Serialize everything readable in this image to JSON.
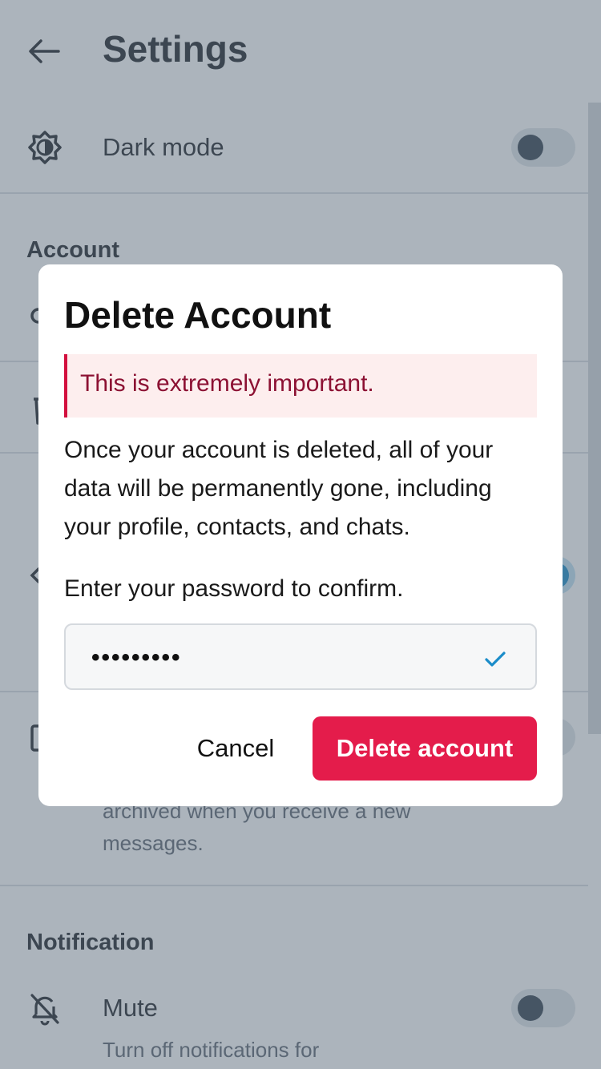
{
  "header": {
    "title": "Settings"
  },
  "dark_mode": {
    "label": "Dark mode",
    "enabled": false
  },
  "account_section": {
    "title": "Account"
  },
  "archive_row": {
    "subtitle": "archived when you receive a new messages."
  },
  "notification_section": {
    "title": "Notification"
  },
  "mute": {
    "label": "Mute",
    "subtitle": "Turn off notifications for",
    "enabled": false
  },
  "dialog": {
    "title": "Delete Account",
    "alert": "This is extremely important.",
    "body": "Once your account is deleted, all of your data will be permanently gone, including your profile, contacts, and chats.",
    "prompt": "Enter your password to confirm.",
    "password_value": "•••••••••",
    "cancel_label": "Cancel",
    "delete_label": "Delete account"
  },
  "colors": {
    "accent": "#1a8cc9",
    "danger": "#e41c4b",
    "alert_bg": "#fdeeee",
    "alert_text": "#8c1133"
  }
}
